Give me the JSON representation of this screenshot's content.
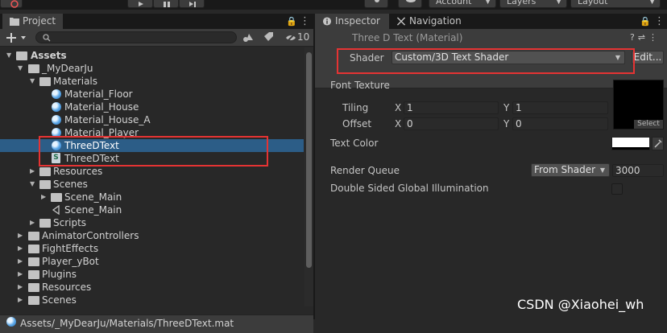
{
  "toolbar": {
    "account": "Account",
    "layers": "Layers",
    "layout": "Layout"
  },
  "project": {
    "tab": "Project",
    "hidden_count": "10",
    "tree": [
      {
        "label": "Assets",
        "bold": true
      },
      {
        "label": "_MyDearJu"
      },
      {
        "label": "Materials"
      },
      {
        "label": "Material_Floor"
      },
      {
        "label": "Material_House"
      },
      {
        "label": "Material_House_A"
      },
      {
        "label": "Material_Player"
      },
      {
        "label": "ThreeDText"
      },
      {
        "label": "ThreeDText"
      },
      {
        "label": "Resources"
      },
      {
        "label": "Scenes"
      },
      {
        "label": "Scene_Main"
      },
      {
        "label": "Scene_Main"
      },
      {
        "label": "Scripts"
      },
      {
        "label": "AnimatorControllers"
      },
      {
        "label": "FightEffects"
      },
      {
        "label": "Player_yBot"
      },
      {
        "label": "Plugins"
      },
      {
        "label": "Resources"
      },
      {
        "label": "Scenes"
      }
    ],
    "status_path": "Assets/_MyDearJu/Materials/ThreeDText.mat"
  },
  "inspector": {
    "tabs": [
      "Inspector",
      "Navigation"
    ],
    "title": "Three D Text (Material)",
    "shader_label": "Shader",
    "shader_value": "Custom/3D Text Shader",
    "edit_button": "Edit...",
    "font_texture": "Font Texture",
    "tiling": "Tiling",
    "offset": "Offset",
    "x": "X",
    "y": "Y",
    "tiling_x": "1",
    "tiling_y": "1",
    "offset_x": "0",
    "offset_y": "0",
    "select": "Select",
    "text_color": "Text Color",
    "render_queue": "Render Queue",
    "render_queue_mode": "From Shader",
    "render_queue_value": "3000",
    "double_sided": "Double Sided Global Illumination"
  },
  "watermark": "CSDN @Xiaohei_wh",
  "colors": {
    "selection": "#2c5d87",
    "highlight_box": "#e53333",
    "panel": "#282828",
    "header": "#3c3c3c"
  }
}
